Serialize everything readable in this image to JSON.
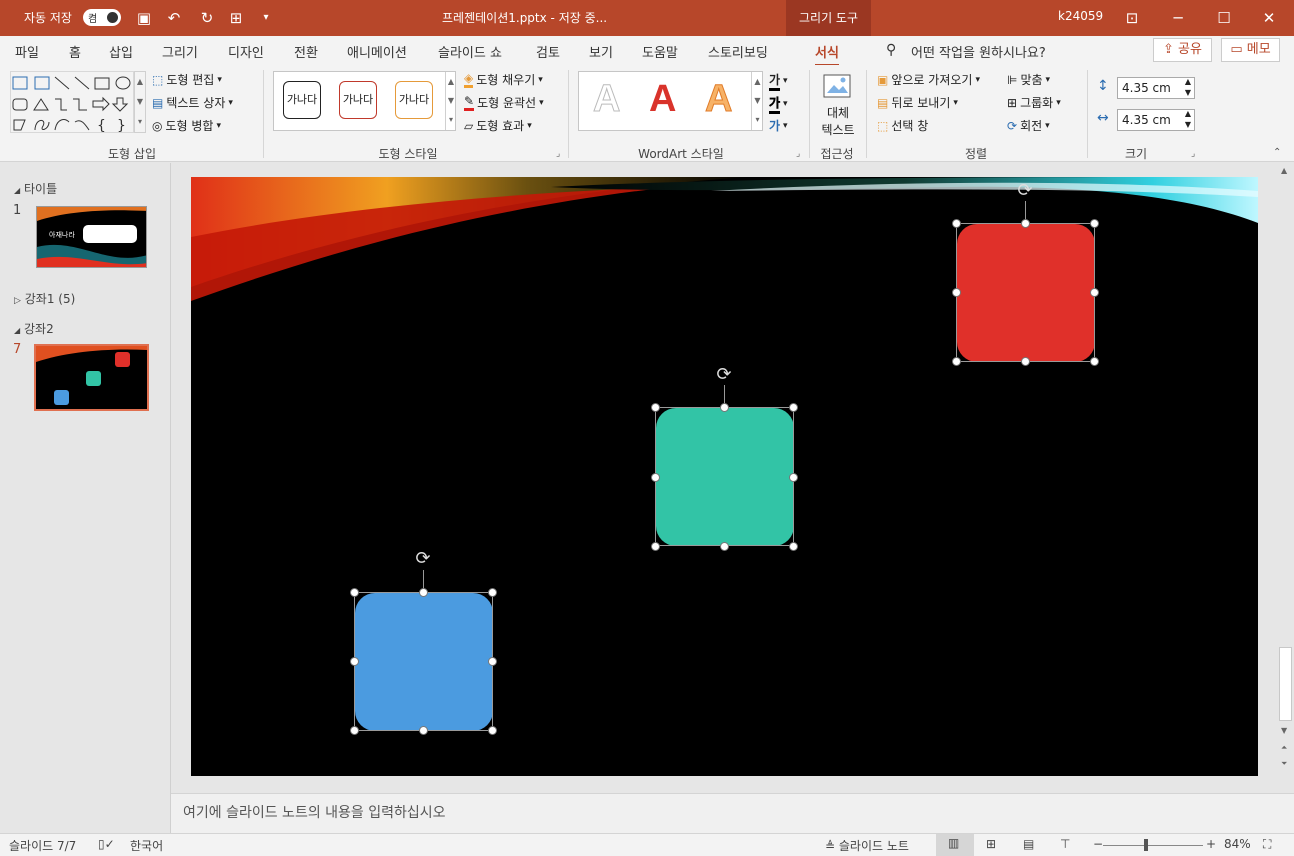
{
  "titlebar": {
    "autosave_label": "자동 저장",
    "autosave_state": "켬",
    "doc_title": "프레젠테이션1.pptx  -  저장 중...",
    "context_tab": "그리기 도구",
    "user": "k24059"
  },
  "tabs": [
    "파일",
    "홈",
    "삽입",
    "그리기",
    "디자인",
    "전환",
    "애니메이션",
    "슬라이드 쇼",
    "검토",
    "보기",
    "도움말",
    "스토리보딩",
    "서식"
  ],
  "search_placeholder": "어떤 작업을 원하시나요?",
  "share_label": "공유",
  "comment_label": "메모",
  "ribbon": {
    "insert_shapes": {
      "label": "도형 삽입",
      "edit_shape": "도형 편집",
      "text_box": "텍스트 상자",
      "merge_shapes": "도형 병합"
    },
    "shape_styles": {
      "label": "도형 스타일",
      "thumb_text": "가나다",
      "fill": "도형 채우기",
      "outline": "도형 윤곽선",
      "effects": "도형 효과"
    },
    "wordart": {
      "label": "WordArt 스타일",
      "sample": "A",
      "text_btn": "가"
    },
    "accessibility": {
      "label": "접근성",
      "alt_text_line1": "대체",
      "alt_text_line2": "텍스트"
    },
    "arrange": {
      "label": "정렬",
      "bring_forward": "앞으로 가져오기",
      "send_backward": "뒤로 보내기",
      "selection_pane": "선택 창",
      "align": "맞춤",
      "group": "그룹화",
      "rotate": "회전"
    },
    "size": {
      "label": "크기",
      "height": "4.35 cm",
      "width": "4.35 cm"
    }
  },
  "slide_pane": {
    "sections": [
      {
        "name": "타이틀"
      },
      {
        "name": "강좌1 (5)"
      },
      {
        "name": "강좌2"
      }
    ],
    "slides": [
      {
        "num": "1",
        "thumb_title": "아재나라"
      },
      {
        "num": "7"
      }
    ]
  },
  "shapes": [
    {
      "name": "red",
      "color": "#e0302a"
    },
    {
      "name": "teal",
      "color": "#32c4a6"
    },
    {
      "name": "blue",
      "color": "#4b9be0"
    }
  ],
  "notes_placeholder": "여기에 슬라이드 노트의 내용을 입력하십시오",
  "status": {
    "slide_counter": "슬라이드 7/7",
    "language": "한국어",
    "notes_btn": "슬라이드 노트",
    "zoom": "84%"
  },
  "colors": {
    "accent": "#b7472a"
  }
}
